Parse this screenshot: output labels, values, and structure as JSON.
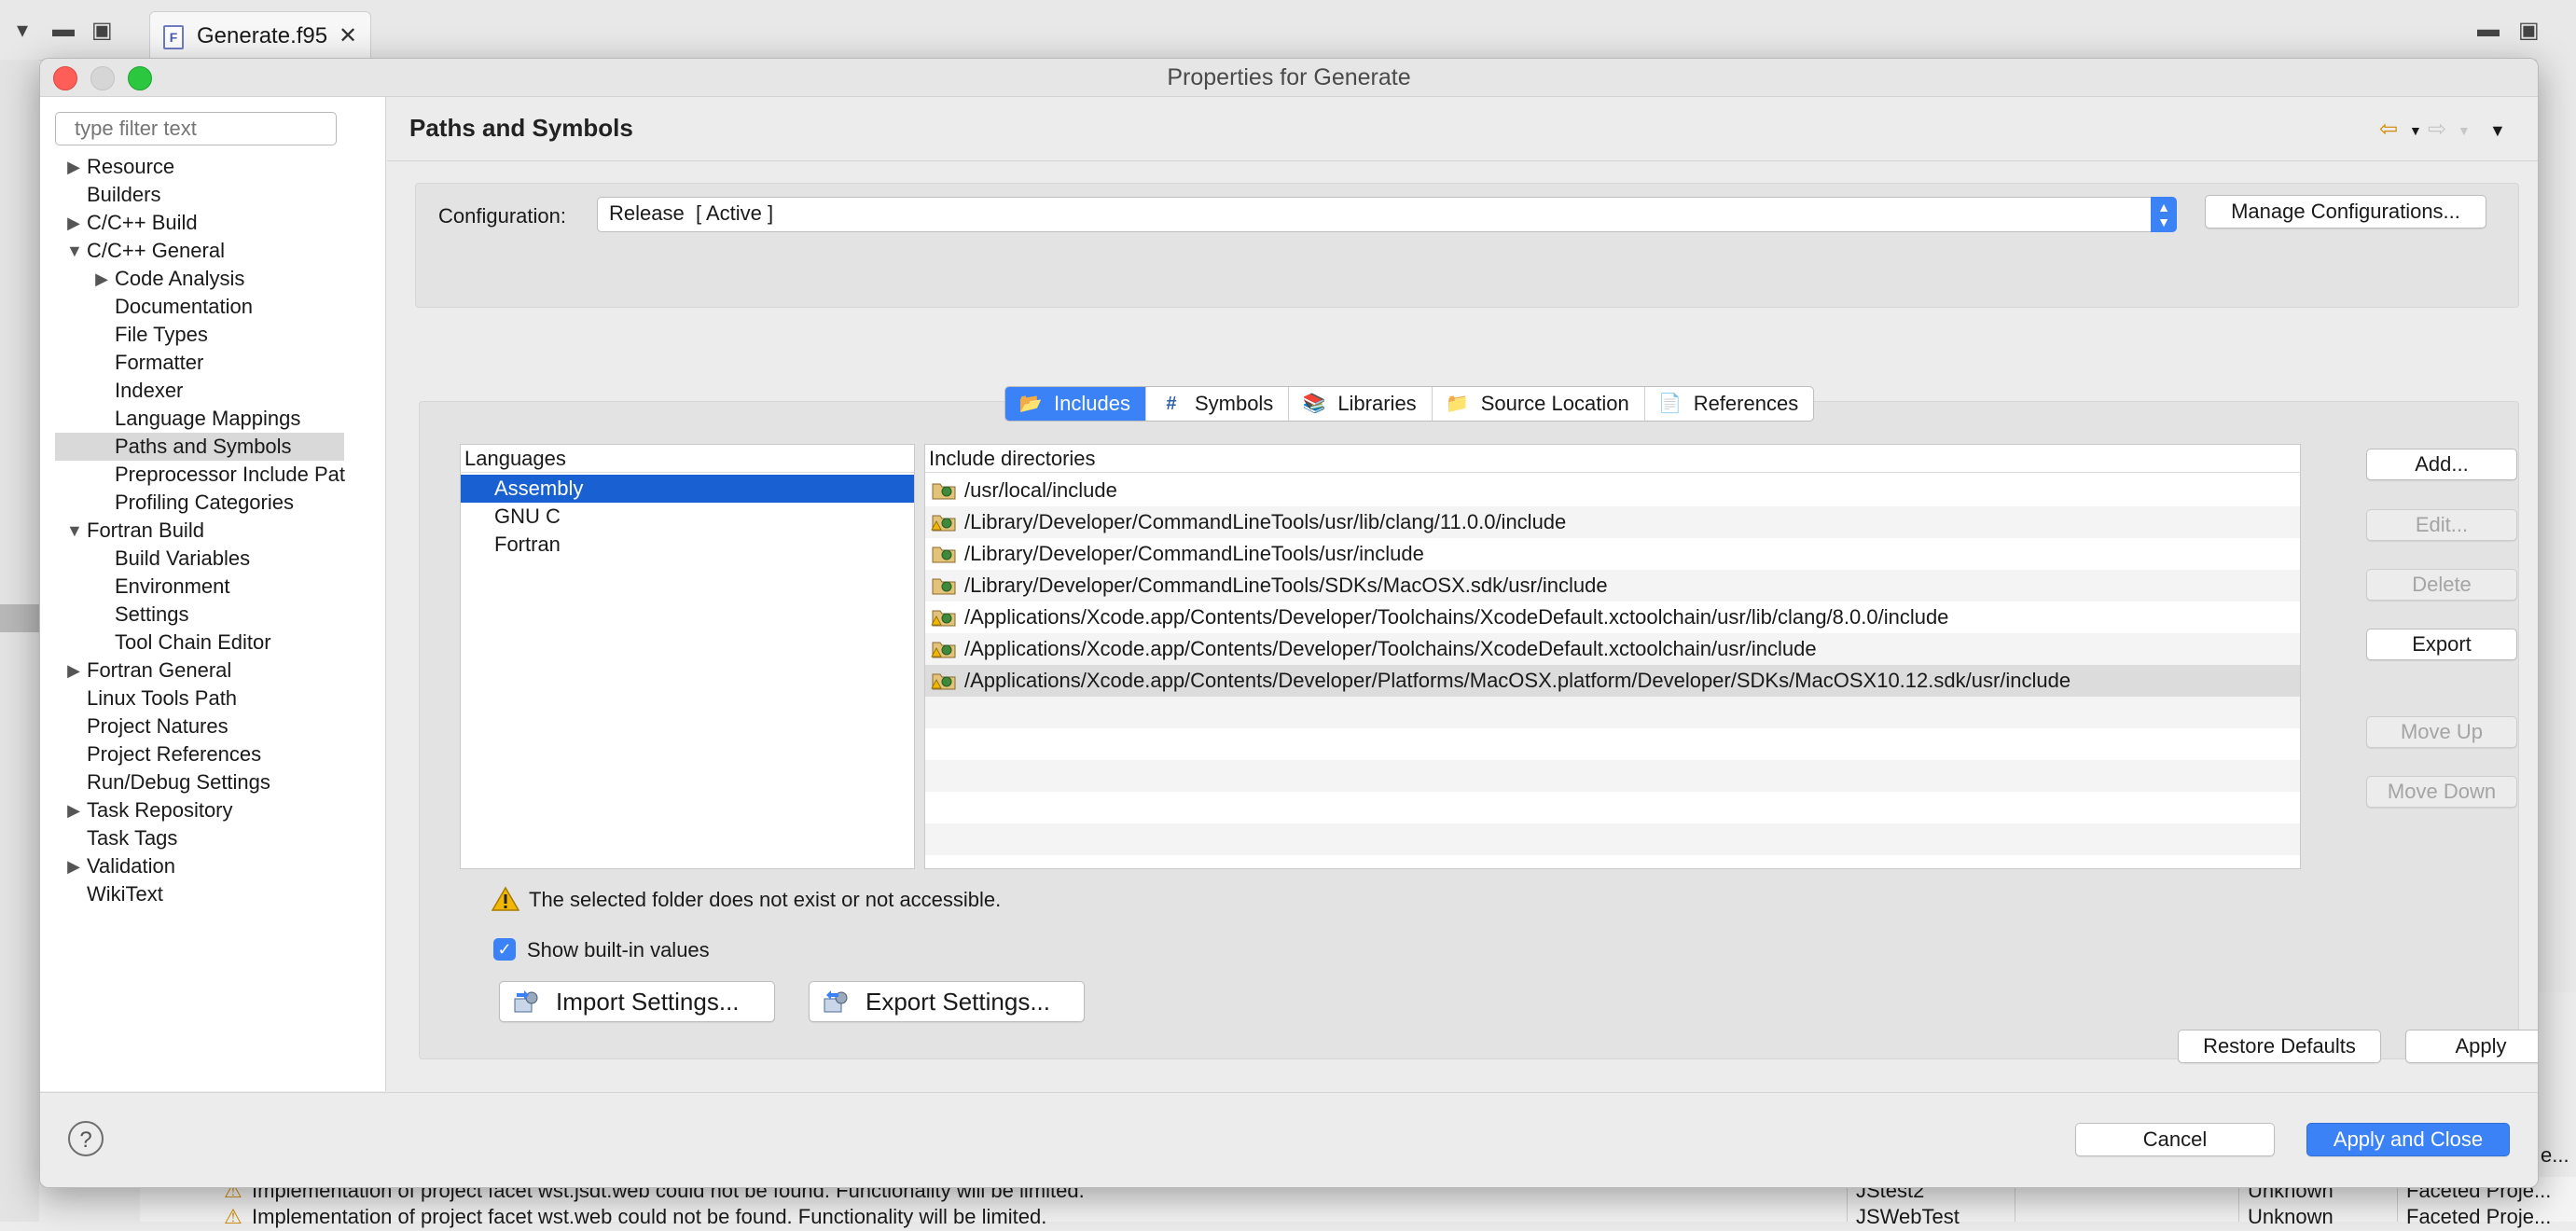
{
  "background": {
    "editor_tab": "Generate.f95",
    "problems": [
      {
        "message": "Implementation of project facet wst.jsdt.web could not be found. Functionality will be limited.",
        "resource": "JStest2",
        "location": "Unknown",
        "type": "Faceted Proje..."
      },
      {
        "message": "Implementation of project facet wst.web could not be found. Functionality will be limited.",
        "resource": "JSWebTest",
        "location": "Unknown",
        "type": "Faceted Proje..."
      }
    ],
    "right_overflow_text": "e..."
  },
  "dialog": {
    "title": "Properties for Generate",
    "filter_placeholder": "type filter text",
    "tree": [
      {
        "label": "Resource",
        "level": 0,
        "twist": "collapsed"
      },
      {
        "label": "Builders",
        "level": 0,
        "twist": "none"
      },
      {
        "label": "C/C++ Build",
        "level": 0,
        "twist": "collapsed"
      },
      {
        "label": "C/C++ General",
        "level": 0,
        "twist": "expanded"
      },
      {
        "label": "Code Analysis",
        "level": 1,
        "twist": "collapsed"
      },
      {
        "label": "Documentation",
        "level": 1,
        "twist": "none"
      },
      {
        "label": "File Types",
        "level": 1,
        "twist": "none"
      },
      {
        "label": "Formatter",
        "level": 1,
        "twist": "none"
      },
      {
        "label": "Indexer",
        "level": 1,
        "twist": "none"
      },
      {
        "label": "Language Mappings",
        "level": 1,
        "twist": "none"
      },
      {
        "label": "Paths and Symbols",
        "level": 1,
        "twist": "none",
        "selected": true
      },
      {
        "label": "Preprocessor Include Pat",
        "level": 1,
        "twist": "none"
      },
      {
        "label": "Profiling Categories",
        "level": 1,
        "twist": "none"
      },
      {
        "label": "Fortran Build",
        "level": 0,
        "twist": "expanded"
      },
      {
        "label": "Build Variables",
        "level": 1,
        "twist": "none"
      },
      {
        "label": "Environment",
        "level": 1,
        "twist": "none"
      },
      {
        "label": "Settings",
        "level": 1,
        "twist": "none"
      },
      {
        "label": "Tool Chain Editor",
        "level": 1,
        "twist": "none"
      },
      {
        "label": "Fortran General",
        "level": 0,
        "twist": "collapsed"
      },
      {
        "label": "Linux Tools Path",
        "level": 0,
        "twist": "none"
      },
      {
        "label": "Project Natures",
        "level": 0,
        "twist": "none"
      },
      {
        "label": "Project References",
        "level": 0,
        "twist": "none"
      },
      {
        "label": "Run/Debug Settings",
        "level": 0,
        "twist": "none"
      },
      {
        "label": "Task Repository",
        "level": 0,
        "twist": "collapsed"
      },
      {
        "label": "Task Tags",
        "level": 0,
        "twist": "none"
      },
      {
        "label": "Validation",
        "level": 0,
        "twist": "collapsed"
      },
      {
        "label": "WikiText",
        "level": 0,
        "twist": "none"
      }
    ],
    "page_title": "Paths and Symbols",
    "configuration": {
      "label": "Configuration:",
      "value": "Release  [ Active ]",
      "manage_button": "Manage Configurations..."
    },
    "tabs": [
      {
        "label": "Includes",
        "icon": "includes-icon",
        "active": true
      },
      {
        "label": "Symbols",
        "icon": "hash-icon",
        "active": false
      },
      {
        "label": "Libraries",
        "icon": "libraries-icon",
        "active": false
      },
      {
        "label": "Source Location",
        "icon": "source-folder-icon",
        "active": false
      },
      {
        "label": "References",
        "icon": "references-icon",
        "active": false
      }
    ],
    "languages_header": "Languages",
    "languages": [
      {
        "label": "Assembly",
        "selected": true
      },
      {
        "label": "GNU C",
        "selected": false
      },
      {
        "label": "Fortran",
        "selected": false
      }
    ],
    "includes_header": "Include directories",
    "includes": [
      {
        "path": "/usr/local/include",
        "warning": false
      },
      {
        "path": "/Library/Developer/CommandLineTools/usr/lib/clang/11.0.0/include",
        "warning": true
      },
      {
        "path": "/Library/Developer/CommandLineTools/usr/include",
        "warning": false
      },
      {
        "path": "/Library/Developer/CommandLineTools/SDKs/MacOSX.sdk/usr/include",
        "warning": false
      },
      {
        "path": "/Applications/Xcode.app/Contents/Developer/Toolchains/XcodeDefault.xctoolchain/usr/lib/clang/8.0.0/include",
        "warning": true
      },
      {
        "path": "/Applications/Xcode.app/Contents/Developer/Toolchains/XcodeDefault.xctoolchain/usr/include",
        "warning": true
      },
      {
        "path": "/Applications/Xcode.app/Contents/Developer/Platforms/MacOSX.platform/Developer/SDKs/MacOSX10.12.sdk/usr/include",
        "warning": true,
        "selected": true
      }
    ],
    "side_buttons": {
      "add": "Add...",
      "edit": "Edit...",
      "delete": "Delete",
      "export": "Export",
      "move_up": "Move Up",
      "move_down": "Move Down"
    },
    "warning_text": "The selected folder does not exist or not accessible.",
    "show_builtin_label": "Show built-in values",
    "show_builtin_checked": true,
    "import_settings": "Import Settings...",
    "export_settings": "Export Settings...",
    "restore_defaults": "Restore Defaults",
    "apply": "Apply",
    "cancel": "Cancel",
    "apply_and_close": "Apply and Close",
    "help": "?"
  },
  "colors": {
    "accent": "#3a82f6",
    "selection": "#1961d2",
    "warning": "#f2b705"
  }
}
